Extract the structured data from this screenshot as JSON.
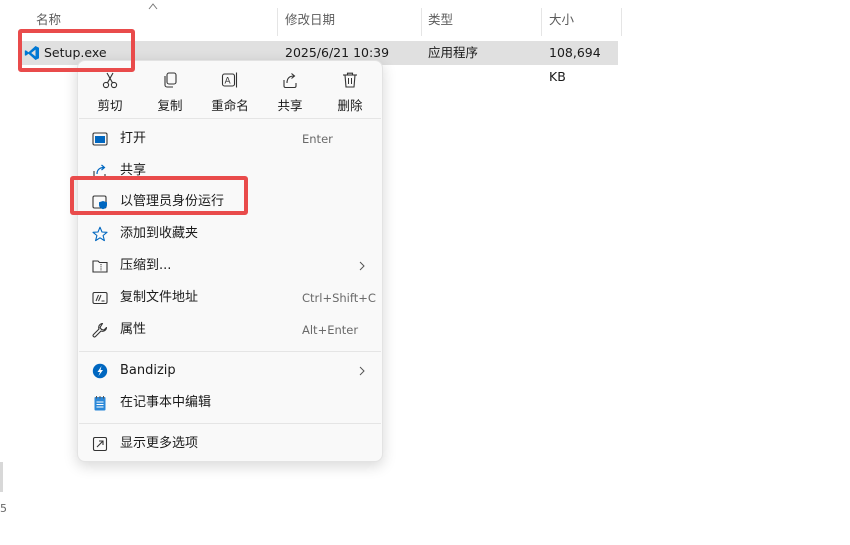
{
  "columns": {
    "name": "名称",
    "modified": "修改日期",
    "type": "类型",
    "size": "大小"
  },
  "file": {
    "name": "Setup.exe",
    "modified": "2025/6/21 10:39",
    "type": "应用程序",
    "size": "108,694 KB",
    "icon": "vscode-icon"
  },
  "menu": {
    "quick_actions": [
      {
        "label": "剪切",
        "icon": "scissors-icon"
      },
      {
        "label": "复制",
        "icon": "copy-icon"
      },
      {
        "label": "重命名",
        "icon": "rename-icon"
      },
      {
        "label": "共享",
        "icon": "share-icon"
      },
      {
        "label": "删除",
        "icon": "trash-icon"
      }
    ],
    "items": [
      {
        "label": "打开",
        "shortcut": "Enter",
        "icon": "open-window-icon"
      },
      {
        "label": "共享",
        "shortcut": "",
        "icon": "share-icon"
      },
      {
        "label": "以管理员身份运行",
        "shortcut": "",
        "icon": "admin-shield-icon"
      },
      {
        "label": "添加到收藏夹",
        "shortcut": "",
        "icon": "star-icon"
      },
      {
        "label": "压缩到...",
        "shortcut": "",
        "icon": "zip-folder-icon"
      },
      {
        "label": "复制文件地址",
        "shortcut": "Ctrl+Shift+C",
        "icon": "copy-path-icon"
      },
      {
        "label": "属性",
        "shortcut": "Alt+Enter",
        "icon": "wrench-icon"
      },
      {
        "label": "Bandizip",
        "shortcut": "",
        "icon": "bandizip-icon"
      },
      {
        "label": "在记事本中编辑",
        "shortcut": "",
        "icon": "notepad-icon"
      },
      {
        "label": "显示更多选项",
        "shortcut": "",
        "icon": "more-options-icon"
      }
    ]
  },
  "edge_glyph": "5",
  "colors": {
    "highlight": "#e94b4b",
    "selection": "#e0e0e0",
    "accent": "#0067c0",
    "vscode": "#0078d4"
  }
}
